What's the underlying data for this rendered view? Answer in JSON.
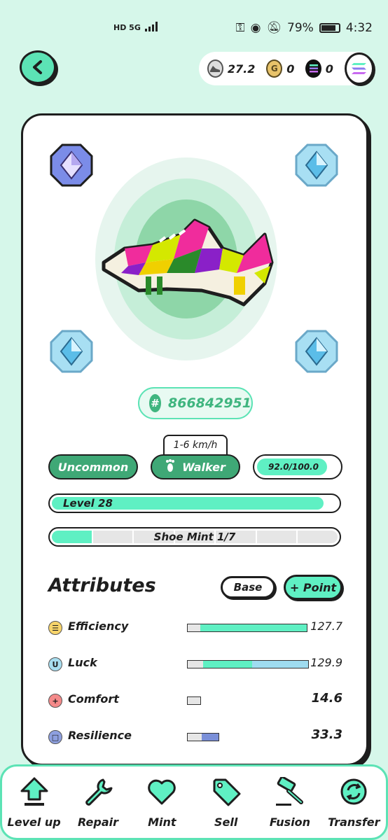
{
  "status_bar": {
    "network": "HD 5G",
    "battery": "79%",
    "time": "4:32"
  },
  "header": {
    "back_icon": "chevron-left-icon",
    "wallet": [
      {
        "icon": "shoe-coin-icon",
        "value": "27.2"
      },
      {
        "icon": "gst-coin-icon",
        "value": "0"
      },
      {
        "icon": "solana-coin-icon",
        "value": "0"
      }
    ],
    "chain_icon": "solana-icon"
  },
  "sneaker": {
    "id": "866842951",
    "speed_range": "1-6 km/h",
    "rarity": "Uncommon",
    "type": "Walker",
    "durability": "92.0/100.0",
    "durability_fraction": 0.92,
    "level_label": "Level 28",
    "level_fraction": 0.95,
    "mint_label": "Shoe Mint 1/7",
    "mint_count": 1,
    "mint_total": 7,
    "sockets": [
      "purple-gem-icon",
      "blue-gem-icon",
      "blue-gem-icon",
      "blue-gem-icon"
    ]
  },
  "attributes": {
    "title": "Attributes",
    "base_label": "Base",
    "point_label": "+ Point",
    "items": [
      {
        "name": "Efficiency",
        "value": "127.7",
        "icon": "efficiency-icon",
        "color": "#f7d46b"
      },
      {
        "name": "Luck",
        "value": "129.9",
        "icon": "luck-icon",
        "color": "#a8def0"
      },
      {
        "name": "Comfort",
        "value": "14.6",
        "icon": "comfort-icon",
        "color": "#f48a8a"
      },
      {
        "name": "Resilience",
        "value": "33.3",
        "icon": "resilience-icon",
        "color": "#8ea0e0"
      }
    ]
  },
  "bottom_nav": [
    {
      "label": "Level up",
      "icon": "level-up-icon"
    },
    {
      "label": "Repair",
      "icon": "wrench-icon"
    },
    {
      "label": "Mint",
      "icon": "heart-icon"
    },
    {
      "label": "Sell",
      "icon": "tag-icon"
    },
    {
      "label": "Fusion",
      "icon": "hammer-icon"
    },
    {
      "label": "Transfer",
      "icon": "transfer-icon"
    }
  ],
  "colors": {
    "background": "#d6f7ea",
    "accent": "#5ff0c3",
    "dark_green": "#3fa876"
  }
}
